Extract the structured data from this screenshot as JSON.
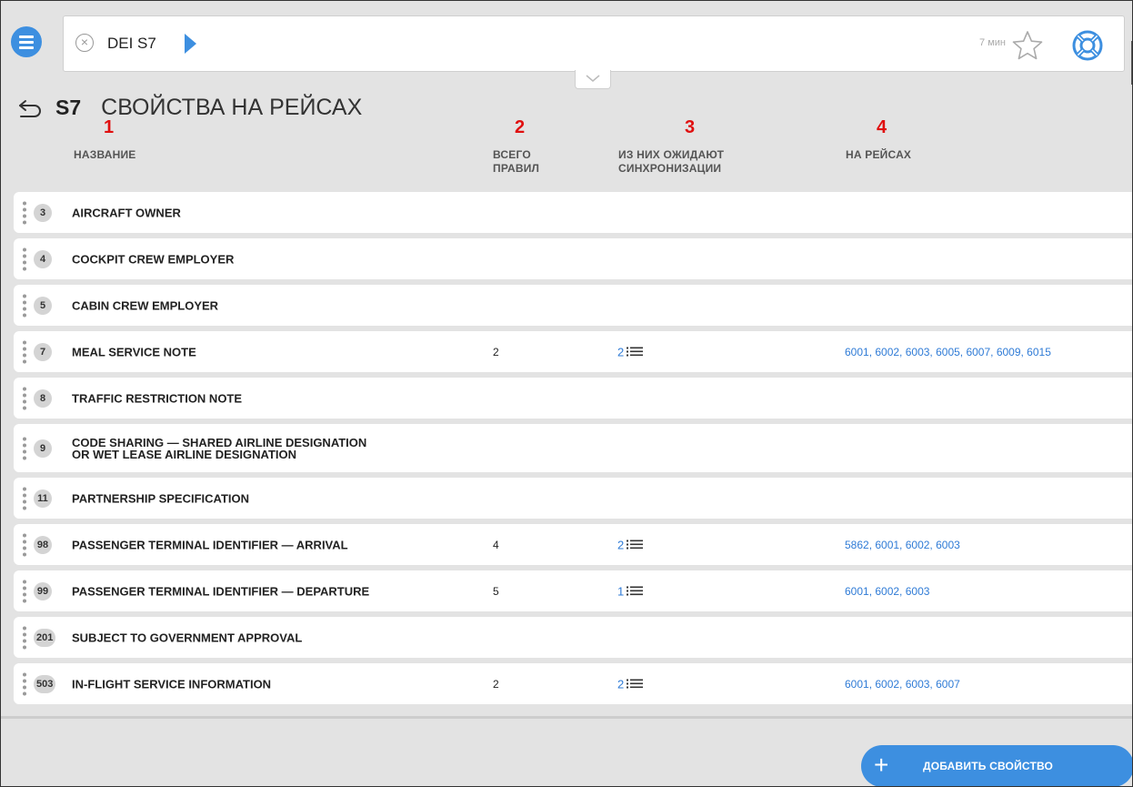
{
  "search": {
    "query": "DEI S7",
    "time_ago": "7 мин"
  },
  "header": {
    "carrier": "S7",
    "title": "СВОЙСТВА НА РЕЙСАХ"
  },
  "columns": [
    {
      "num": "1",
      "label_lines": [
        "НАЗВАНИЕ"
      ]
    },
    {
      "num": "2",
      "label_lines": [
        "ВСЕГО",
        "ПРАВИЛ"
      ]
    },
    {
      "num": "3",
      "label_lines": [
        "ИЗ НИХ ОЖИДАЮТ",
        "СИНХРОНИЗАЦИИ"
      ]
    },
    {
      "num": "4",
      "label_lines": [
        "НА РЕЙСАХ"
      ]
    }
  ],
  "rows": [
    {
      "id": "3",
      "name_lines": [
        "AIRCRAFT OWNER"
      ],
      "total": "",
      "pending": "",
      "flights": ""
    },
    {
      "id": "4",
      "name_lines": [
        "COCKPIT CREW EMPLOYER"
      ],
      "total": "",
      "pending": "",
      "flights": ""
    },
    {
      "id": "5",
      "name_lines": [
        "CABIN CREW EMPLOYER"
      ],
      "total": "",
      "pending": "",
      "flights": ""
    },
    {
      "id": "7",
      "name_lines": [
        "MEAL SERVICE NOTE"
      ],
      "total": "2",
      "pending": "2",
      "flights": "6001, 6002, 6003, 6005, 6007, 6009, 6015"
    },
    {
      "id": "8",
      "name_lines": [
        "TRAFFIC RESTRICTION NOTE"
      ],
      "total": "",
      "pending": "",
      "flights": ""
    },
    {
      "id": "9",
      "name_lines": [
        "CODE SHARING — SHARED AIRLINE DESIGNATION",
        "OR WET LEASE AIRLINE DESIGNATION"
      ],
      "total": "",
      "pending": "",
      "flights": ""
    },
    {
      "id": "11",
      "name_lines": [
        "PARTNERSHIP SPECIFICATION"
      ],
      "total": "",
      "pending": "",
      "flights": ""
    },
    {
      "id": "98",
      "name_lines": [
        "PASSENGER TERMINAL IDENTIFIER — ARRIVAL"
      ],
      "total": "4",
      "pending": "2",
      "flights": "5862, 6001, 6002, 6003"
    },
    {
      "id": "99",
      "name_lines": [
        "PASSENGER TERMINAL IDENTIFIER — DEPARTURE"
      ],
      "total": "5",
      "pending": "1",
      "flights": "6001, 6002, 6003"
    },
    {
      "id": "201",
      "name_lines": [
        "SUBJECT TO GOVERNMENT APPROVAL"
      ],
      "total": "",
      "pending": "",
      "flights": ""
    },
    {
      "id": "503",
      "name_lines": [
        "IN-FLIGHT SERVICE INFORMATION"
      ],
      "total": "2",
      "pending": "2",
      "flights": "6001, 6002, 6003, 6007"
    }
  ],
  "add_button": {
    "label": "ДОБАВИТЬ СВОЙСТВО",
    "icon": "plus-icon"
  },
  "icons": {
    "menu": "menu-icon",
    "clear": "close-circle-icon",
    "go": "play-arrow-icon",
    "favorite": "star-outline-icon",
    "help": "lifebuoy-icon",
    "back": "back-arrow-icon",
    "collapse": "chevron-down-icon",
    "pending_list": "list-icon"
  },
  "colors": {
    "accent": "#3d8fe0",
    "link": "#2f7bd6",
    "annotation": "#e01010",
    "background": "#e3e3e3"
  }
}
